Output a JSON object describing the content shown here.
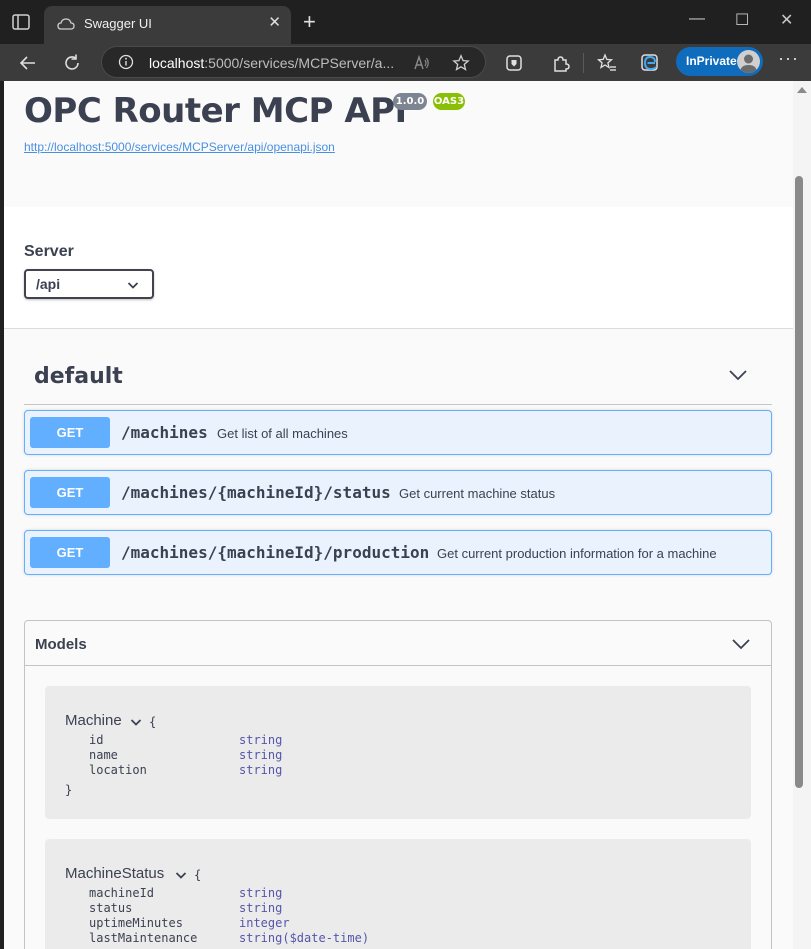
{
  "browser": {
    "tab_title": "Swagger UI",
    "tab_close": "✕",
    "new_tab": "+",
    "window_minimize": "—",
    "window_maximize": "☐",
    "window_close": "✕",
    "address_host": "localhost",
    "address_rest": ":5000/services/MCPServer/a...",
    "inprivate_label": "InPrivate",
    "more_label": "···"
  },
  "info": {
    "title": "OPC Router MCP API",
    "version": "1.0.0",
    "oas_badge": "OAS3",
    "spec_url": "http://localhost:5000/services/MCPServer/api/openapi.json"
  },
  "server": {
    "label": "Server",
    "selected": "/api"
  },
  "tag": {
    "name": "default"
  },
  "operations": [
    {
      "method": "GET",
      "path": "/machines",
      "summary": "Get list of all machines"
    },
    {
      "method": "GET",
      "path": "/machines/{machineId}/status",
      "summary": "Get current machine status"
    },
    {
      "method": "GET",
      "path": "/machines/{machineId}/production",
      "summary": "Get current production information for a machine"
    }
  ],
  "models": {
    "title": "Models",
    "open_brace": "{",
    "close_brace": "}",
    "items": [
      {
        "name": "Machine",
        "properties": [
          {
            "name": "id",
            "type": "string"
          },
          {
            "name": "name",
            "type": "string"
          },
          {
            "name": "location",
            "type": "string"
          }
        ]
      },
      {
        "name": "MachineStatus",
        "properties": [
          {
            "name": "machineId",
            "type": "string"
          },
          {
            "name": "status",
            "type": "string"
          },
          {
            "name": "uptimeMinutes",
            "type": "integer"
          },
          {
            "name": "lastMaintenance",
            "type": "string($date-time)"
          }
        ]
      }
    ]
  },
  "colors": {
    "get_method": "#61affe",
    "get_background": "#eaf3fd",
    "title_text": "#3b4151",
    "link": "#4990e2",
    "badge_version": "#7d8492",
    "badge_oas": "#89bf04",
    "inprivate": "#0f6cbd"
  }
}
